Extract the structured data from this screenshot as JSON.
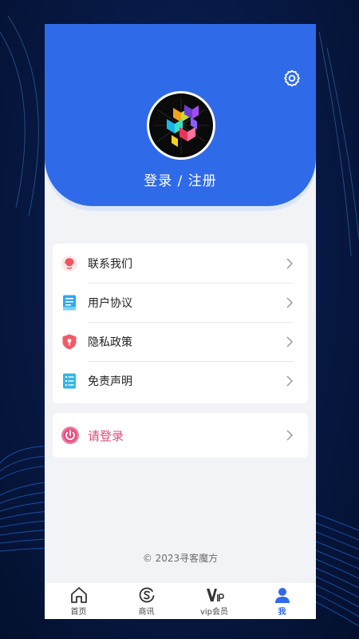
{
  "header": {
    "login_register_label": "登录 / 注册",
    "settings_icon": "gear-icon",
    "avatar_icon": "app-logo-cube-x"
  },
  "menu": {
    "items": [
      {
        "label": "联系我们",
        "icon": "customer-service-icon"
      },
      {
        "label": "用户协议",
        "icon": "document-icon"
      },
      {
        "label": "隐私政策",
        "icon": "shield-lock-icon"
      },
      {
        "label": "免责声明",
        "icon": "list-icon"
      }
    ]
  },
  "login": {
    "label": "请登录",
    "icon": "power-icon"
  },
  "footer": {
    "copyright": "© 2023寻客魔方"
  },
  "tabbar": {
    "tabs": [
      {
        "label": "首页",
        "icon": "home-icon"
      },
      {
        "label": "商讯",
        "icon": "news-icon"
      },
      {
        "label": "vip会员",
        "icon": "vip-icon"
      },
      {
        "label": "我",
        "icon": "user-icon",
        "active": true
      }
    ]
  },
  "colors": {
    "primary": "#2f6ae8",
    "login_accent": "#e04b7a",
    "background_outer": "#071a48"
  }
}
